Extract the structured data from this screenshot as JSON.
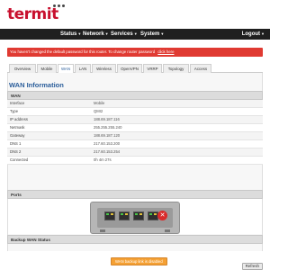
{
  "brand": {
    "logo_text": "termit"
  },
  "nav": {
    "items": [
      {
        "label": "Status"
      },
      {
        "label": "Network"
      },
      {
        "label": "Services"
      },
      {
        "label": "System"
      }
    ],
    "logout_label": "Logout"
  },
  "warning": {
    "text": "You haven't changed the default password for this router. To change router password",
    "link": "click here"
  },
  "tabs": [
    {
      "label": "Overview",
      "active": false
    },
    {
      "label": "Mobile",
      "active": false
    },
    {
      "label": "WAN",
      "active": true
    },
    {
      "label": "LAN",
      "active": false
    },
    {
      "label": "Wireless",
      "active": false
    },
    {
      "label": "OpenVPN",
      "active": false
    },
    {
      "label": "VRRP",
      "active": false
    },
    {
      "label": "Topology",
      "active": false
    },
    {
      "label": "Access",
      "active": false
    }
  ],
  "wan": {
    "title": "WAN Information",
    "table_header": "WAN",
    "rows": [
      {
        "label": "Interface",
        "value": "Mobile"
      },
      {
        "label": "Type",
        "value": "QMI2"
      },
      {
        "label": "IP address",
        "value": "188.69.187.116"
      },
      {
        "label": "Netmask",
        "value": "255.255.255.240"
      },
      {
        "label": "Gateway",
        "value": "188.69.187.120"
      },
      {
        "label": "DNS 1",
        "value": "217.60.153.200"
      },
      {
        "label": "DNS 2",
        "value": "217.60.153.254"
      },
      {
        "label": "Connected",
        "value": "0h 4m 27s"
      }
    ]
  },
  "ports": {
    "header": "Ports"
  },
  "backup": {
    "header": "Backup WAN Status",
    "status": "WAN backup link is disabled"
  },
  "refresh_label": "Refresh",
  "colors": {
    "brand_red": "#c8102e",
    "warning_bg": "#e03a32",
    "nav_bg": "#1f1f1f",
    "accent_blue": "#2a5d9a",
    "badge_orange": "#f5a033"
  }
}
